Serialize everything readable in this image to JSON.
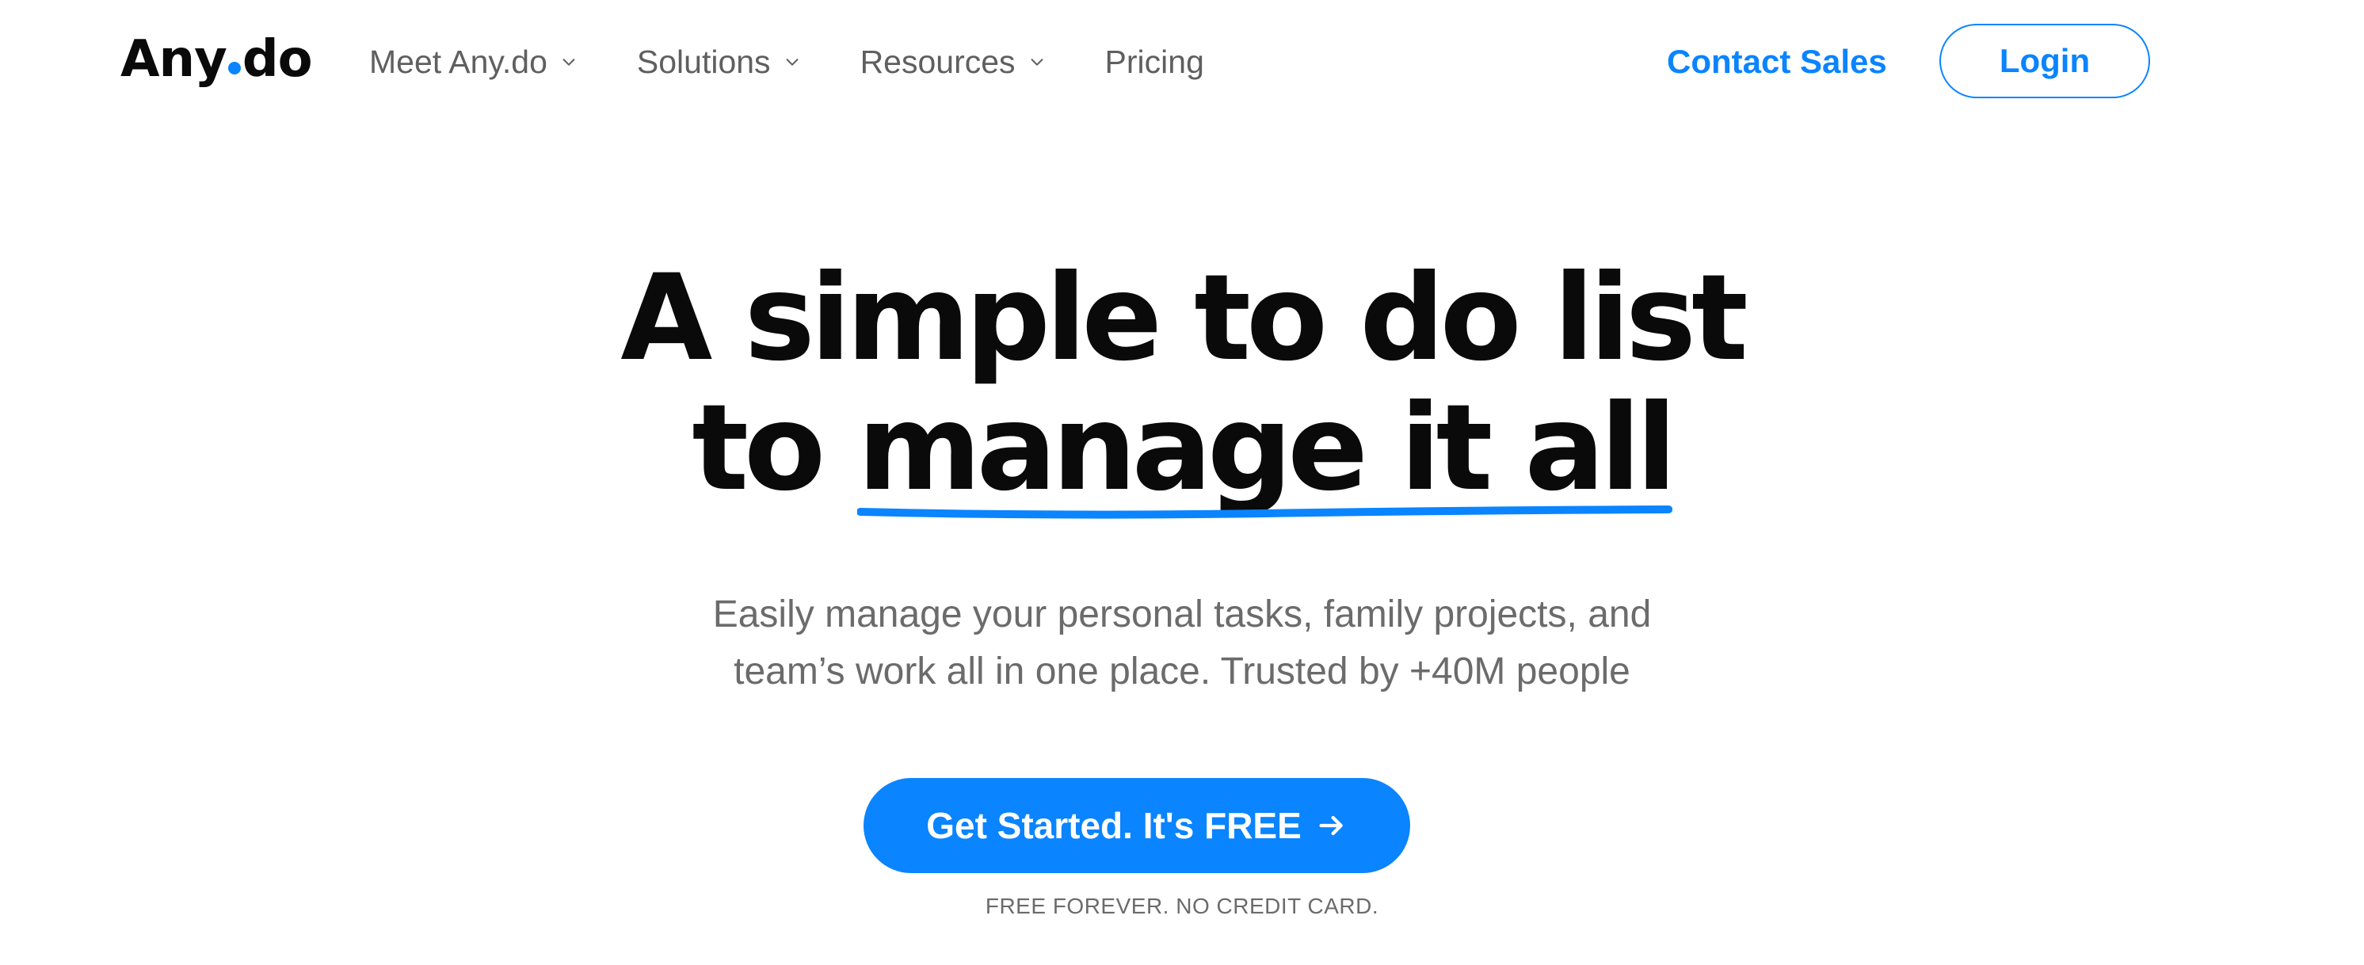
{
  "header": {
    "logo_prefix": "Any",
    "logo_suffix": "do",
    "nav": [
      {
        "label": "Meet Any.do",
        "icon": "chevron-down-icon"
      },
      {
        "label": "Solutions",
        "icon": "chevron-down-icon"
      },
      {
        "label": "Resources",
        "icon": "chevron-down-icon"
      },
      {
        "label": "Pricing"
      }
    ],
    "contact_sales": "Contact Sales",
    "login": "Login"
  },
  "hero": {
    "title_line1": "A simple to do list",
    "title_line2_prefix": "to ",
    "title_line2_highlight": "manage it all",
    "subtitle_line1": "Easily manage your personal tasks, family projects, and",
    "subtitle_line2": "team’s work all in one place. Trusted by +40M people",
    "cta_label": "Get Started. It's FREE",
    "cta_icon": "arrow-right-icon",
    "cta_note": "FREE FOREVER. NO CREDIT CARD."
  },
  "colors": {
    "brand_blue": "#0a84ff",
    "text_dark": "#0a0a0a",
    "text_muted": "#6b6b6b",
    "background": "#ffffff"
  }
}
